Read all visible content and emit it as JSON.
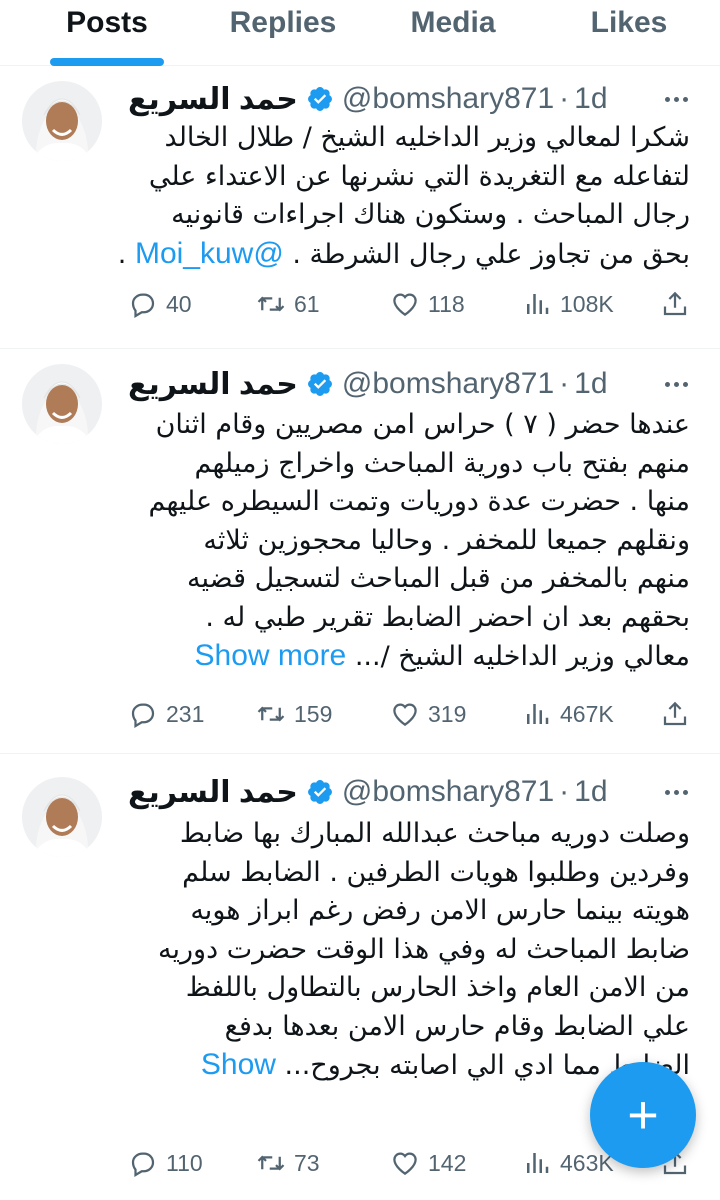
{
  "tabs": [
    {
      "label": "Posts",
      "active": true
    },
    {
      "label": "Replies",
      "active": false
    },
    {
      "label": "Media",
      "active": false
    },
    {
      "label": "Likes",
      "active": false
    }
  ],
  "tweets": [
    {
      "name": "حمد السريع",
      "handle": "@bomshary871",
      "separator": "·",
      "time": "1d",
      "lines": [
        "شكرا لمعالي وزير الداخليه الشيخ / طلال الخالد",
        "لتفاعله مع التغريدة التي نشرنها عن الاعتداء علي",
        "رجال المباحث . وستكون هناك اجراءات قانونيه",
        "بحق من تجاوز علي رجال الشرطة ."
      ],
      "mention": "@Moi_kuw",
      "trailing": ".",
      "stats": {
        "replies": "40",
        "reposts": "61",
        "likes": "118",
        "views": "108K"
      }
    },
    {
      "name": "حمد السريع",
      "handle": "@bomshary871",
      "separator": "·",
      "time": "1d",
      "lines": [
        "عندها حضر ( ٧ ) حراس امن مصريين وقام اثنان",
        "منهم بفتح باب دورية المباحث واخراج زميلهم",
        "منها . حضرت عدة دوريات وتمت السيطره عليهم",
        "ونقلهم جميعا للمخفر . وحاليا محجوزين ثلاثه",
        "منهم بالمخفر من قبل المباحث لتسجيل قضيه",
        "بحقهم بعد ان احضر الضابط تقرير طبي له .",
        "معالي وزير الداخليه الشيخ /..."
      ],
      "show_more": "Show more",
      "stats": {
        "replies": "231",
        "reposts": "159",
        "likes": "319",
        "views": "467K"
      }
    },
    {
      "name": "حمد السريع",
      "handle": "@bomshary871",
      "separator": "·",
      "time": "1d",
      "lines": [
        "وصلت دوريه مباحث عبدالله المبارك بها ضابط",
        "وفردين وطلبوا هويات الطرفين . الضابط سلم",
        "هويته بينما حارس الامن رفض رغم ابراز هويه",
        "ضابط المباحث له وفي هذا الوقت حضرت دوريه",
        "من الامن العام واخذ الحارس بالتطاول باللفظ",
        "علي الضابط  وقام حارس الامن بعدها بدفع",
        "الضابط مما ادي الي اصابته بجروح..."
      ],
      "show_more": "Show",
      "stats": {
        "replies": "110",
        "reposts": "73",
        "likes": "142",
        "views": "463K"
      }
    }
  ],
  "fab": {
    "label": "+"
  },
  "colors": {
    "accent": "#1d9bf0",
    "text": "#0f1419",
    "muted": "#536471",
    "divider": "#eff3f4"
  }
}
